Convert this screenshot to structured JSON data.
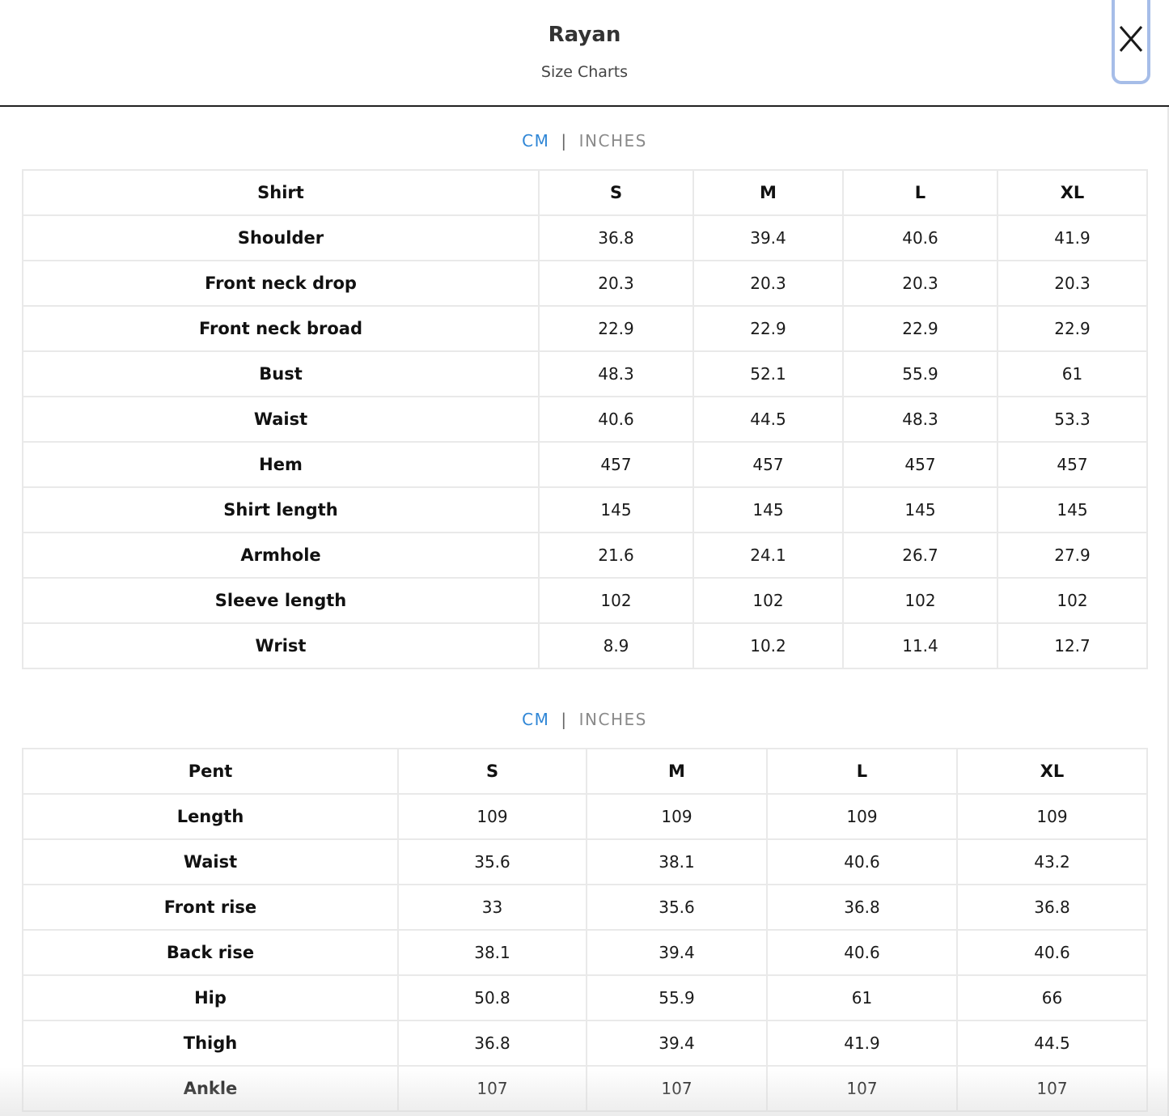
{
  "header": {
    "title": "Rayan",
    "subtitle": "Size Charts",
    "close_label": "X"
  },
  "unit_toggle": {
    "cm": "CM",
    "separator": "|",
    "inches": "INCHES"
  },
  "shirt_table": {
    "columns": [
      "Shirt",
      "S",
      "M",
      "L",
      "XL"
    ],
    "rows": [
      [
        "Shoulder",
        "36.8",
        "39.4",
        "40.6",
        "41.9"
      ],
      [
        "Front neck drop",
        "20.3",
        "20.3",
        "20.3",
        "20.3"
      ],
      [
        "Front neck broad",
        "22.9",
        "22.9",
        "22.9",
        "22.9"
      ],
      [
        "Bust",
        "48.3",
        "52.1",
        "55.9",
        "61"
      ],
      [
        "Waist",
        "40.6",
        "44.5",
        "48.3",
        "53.3"
      ],
      [
        "Hem",
        "457",
        "457",
        "457",
        "457"
      ],
      [
        "Shirt length",
        "145",
        "145",
        "145",
        "145"
      ],
      [
        "Armhole",
        "21.6",
        "24.1",
        "26.7",
        "27.9"
      ],
      [
        "Sleeve length",
        "102",
        "102",
        "102",
        "102"
      ],
      [
        "Wrist",
        "8.9",
        "10.2",
        "11.4",
        "12.7"
      ]
    ]
  },
  "pent_table": {
    "columns": [
      "Pent",
      "S",
      "M",
      "L",
      "XL"
    ],
    "rows": [
      [
        "Length",
        "109",
        "109",
        "109",
        "109"
      ],
      [
        "Waist",
        "35.6",
        "38.1",
        "40.6",
        "43.2"
      ],
      [
        "Front rise",
        "33",
        "35.6",
        "36.8",
        "36.8"
      ],
      [
        "Back rise",
        "38.1",
        "39.4",
        "40.6",
        "40.6"
      ],
      [
        "Hip",
        "50.8",
        "55.9",
        "61",
        "66"
      ],
      [
        "Thigh",
        "36.8",
        "39.4",
        "41.9",
        "44.5"
      ],
      [
        "Ankle",
        "107",
        "107",
        "107",
        "107"
      ]
    ]
  }
}
